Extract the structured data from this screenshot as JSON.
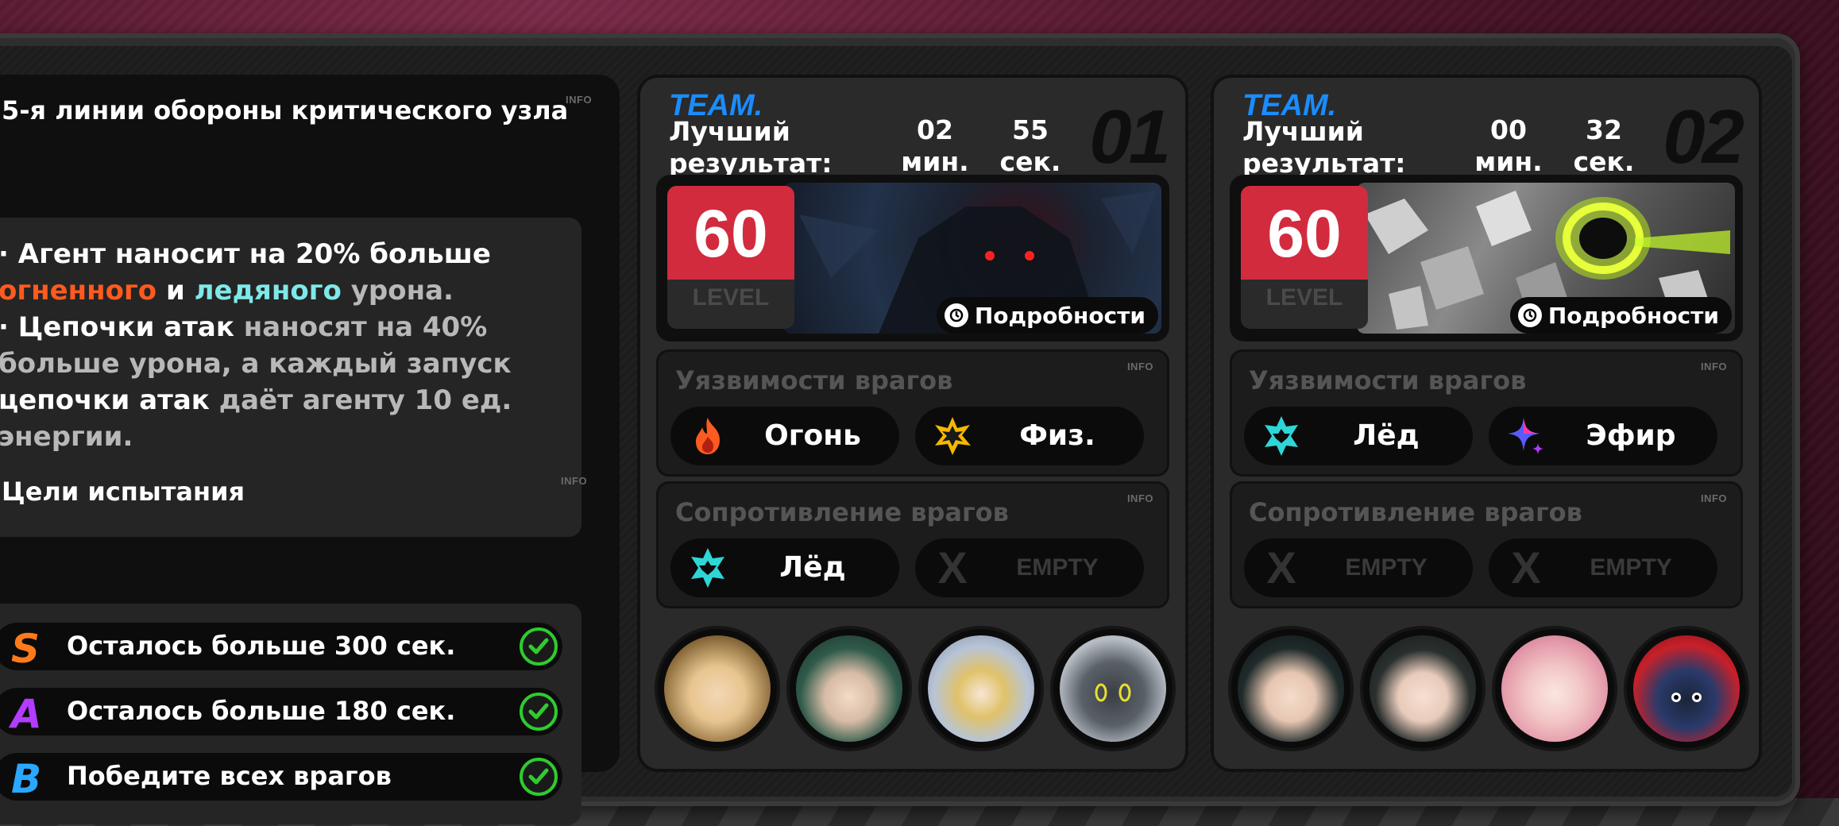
{
  "left": {
    "node_title": "5-я линии обороны критического узла",
    "info": "INFO",
    "description": {
      "line1": [
        "· Агент наносит на 20% больше"
      ],
      "line2": {
        "fire": "огненного",
        "and": " и ",
        "ice": "ледяного",
        "rest": " урона."
      },
      "line3": {
        "white": "· Цепочки атак",
        "grey": " наносят на 40%"
      },
      "line4": "больше урона, а каждый запуск",
      "line5": {
        "white": "цепочки атак",
        "grey": " даёт агенту 10 ед."
      },
      "line6": "энергии."
    },
    "goals_title": "Цели испытания",
    "goals_info": "INFO",
    "goals": [
      {
        "grade": "S",
        "text": "Осталось больше 300 сек.",
        "grade_color": "#ff7a1a",
        "done": true
      },
      {
        "grade": "A",
        "text": "Осталось больше 180 сек.",
        "grade_color": "#b23cff",
        "done": true
      },
      {
        "grade": "B",
        "text": "Победите всех врагов",
        "grade_color": "#2aa8ff",
        "done": true
      }
    ]
  },
  "teams": [
    {
      "team_label": "TEAM.",
      "best_line1": "Лучший",
      "best_line2": "результат:",
      "minutes": "02",
      "seconds": "55",
      "min_unit": "мин.",
      "sec_unit": "сек.",
      "number": "01",
      "level": "60",
      "level_word": "LEVEL",
      "details": "Подробности",
      "weak_title": "Уязвимости врагов",
      "weak_info": "INFO",
      "weaknesses": [
        {
          "label": "Огонь",
          "icon": "fire-icon"
        },
        {
          "label": "Физ.",
          "icon": "physical-icon"
        }
      ],
      "resist_title": "Сопротивление врагов",
      "resist_info": "INFO",
      "resistances": [
        {
          "label": "Лёд",
          "icon": "ice-icon"
        },
        {
          "label": "EMPTY",
          "icon": "empty-x-icon"
        }
      ],
      "portraits": [
        "blonde-agent",
        "green-hair-agent",
        "silver-hair-agent",
        "robot-agent"
      ]
    },
    {
      "team_label": "TEAM.",
      "best_line1": "Лучший",
      "best_line2": "результат:",
      "minutes": "00",
      "seconds": "32",
      "min_unit": "мин.",
      "sec_unit": "сек.",
      "number": "02",
      "level": "60",
      "level_word": "LEVEL",
      "details": "Подробности",
      "weak_title": "Уязвимости врагов",
      "weak_info": "INFO",
      "weaknesses": [
        {
          "label": "Лёд",
          "icon": "ice-icon"
        },
        {
          "label": "Эфир",
          "icon": "ether-icon"
        }
      ],
      "resist_title": "Сопротивление врагов",
      "resist_info": "INFO",
      "resistances": [
        {
          "label": "EMPTY",
          "icon": "empty-x-icon"
        },
        {
          "label": "EMPTY",
          "icon": "empty-x-icon"
        }
      ],
      "portraits": [
        "dark-hair-agent",
        "dark-bob-agent",
        "pink-hair-agent",
        "red-helmet-agent"
      ]
    }
  ]
}
